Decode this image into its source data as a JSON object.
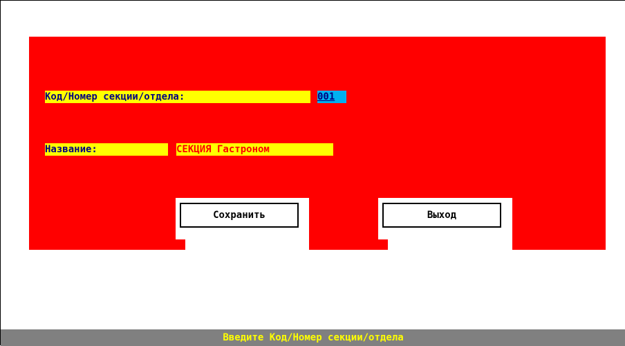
{
  "form": {
    "code_label": "Код/Номер секции/отдела:",
    "code_value": "001",
    "name_label": "Название:",
    "name_value": "СЕКЦИЯ Гастроном"
  },
  "buttons": {
    "save_label": "Сохранить",
    "exit_label": "Выход"
  },
  "status_bar": {
    "hint": "Введите Код/Номер секции/отдела"
  },
  "colors": {
    "panel": "#ff0000",
    "label_background": "#ffff00",
    "label_text": "#000080",
    "active_input": "#00b0f0",
    "name_value_text": "#ff0000",
    "status_bar": "#808080",
    "status_text": "#ffff00"
  }
}
